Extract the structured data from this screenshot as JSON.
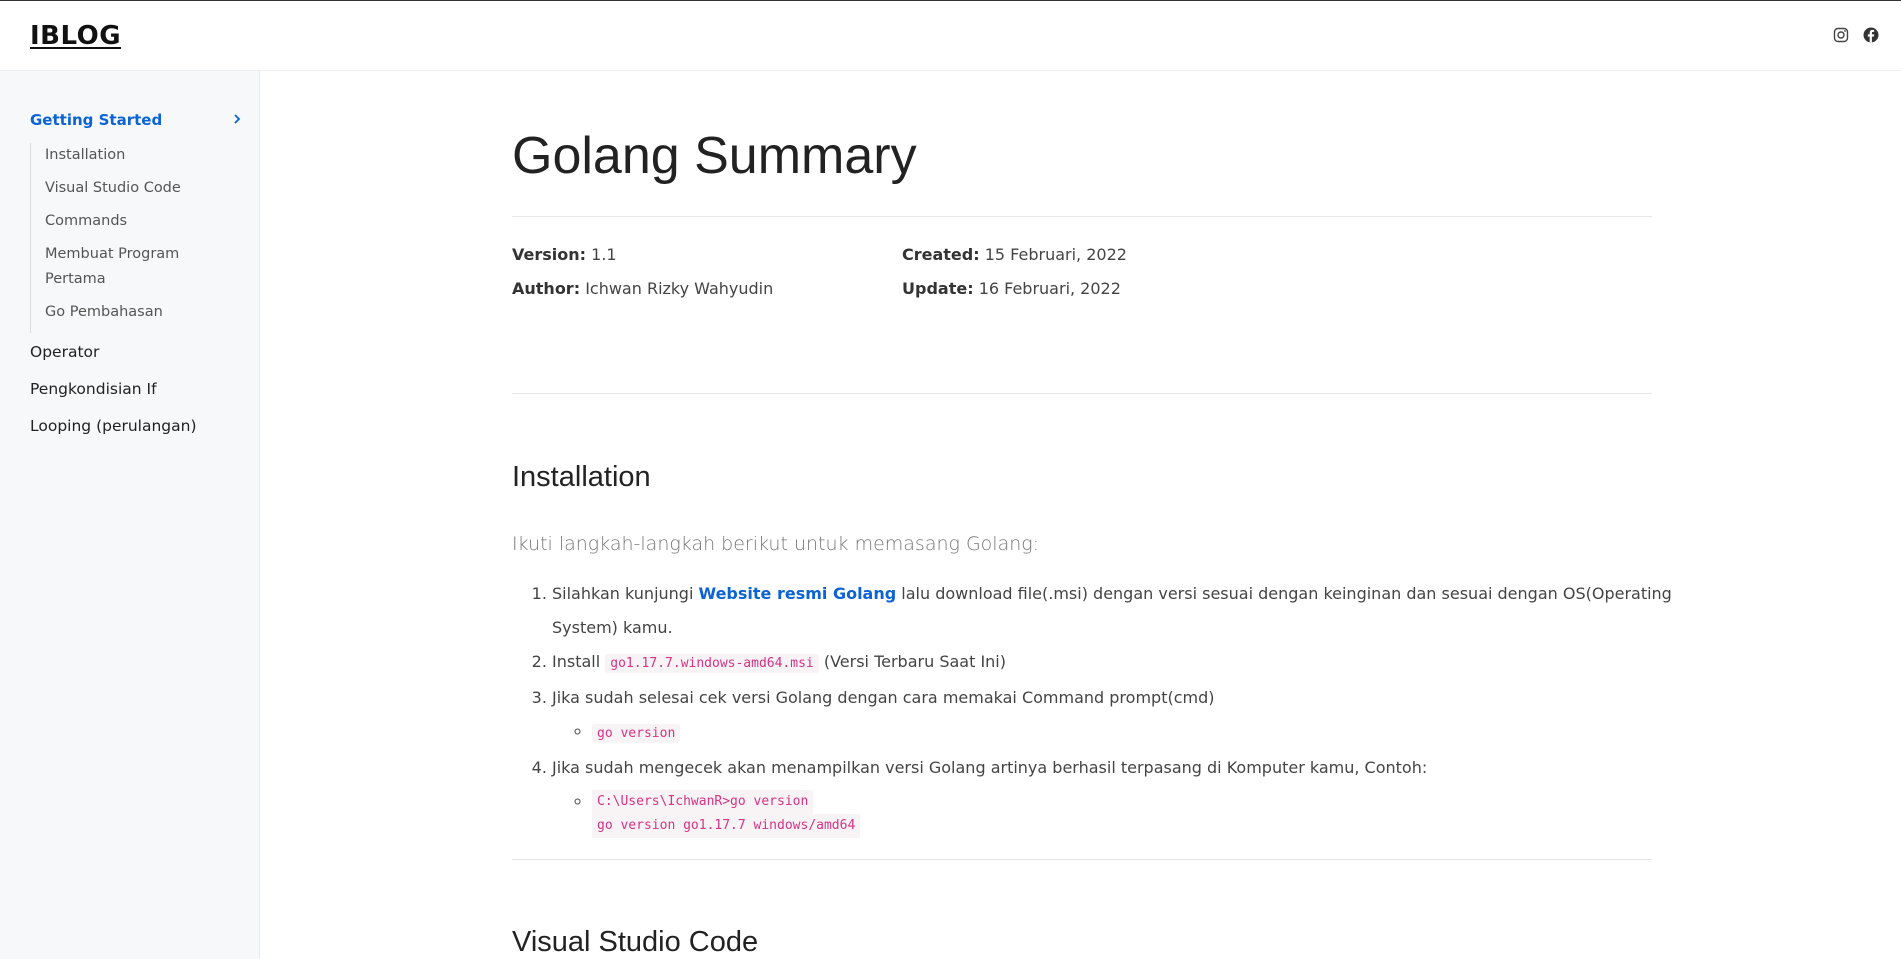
{
  "header": {
    "brand": "IBLOG",
    "icons": [
      "instagram-icon",
      "facebook-icon"
    ]
  },
  "sidebar": {
    "group_title": "Getting Started",
    "sub_items": [
      {
        "label": "Installation"
      },
      {
        "label": "Visual Studio Code"
      },
      {
        "label": "Commands"
      },
      {
        "label": "Membuat Program Pertama"
      },
      {
        "label": "Go Pembahasan"
      }
    ],
    "top_items": [
      {
        "label": "Operator"
      },
      {
        "label": "Pengkondisian If"
      },
      {
        "label": "Looping (perulangan)"
      }
    ]
  },
  "main": {
    "title": "Golang Summary",
    "meta": {
      "version_label": "Version:",
      "version_value": "1.1",
      "author_label": "Author:",
      "author_value": "Ichwan Rizky Wahyudin",
      "created_label": "Created:",
      "created_value": "15 Februari, 2022",
      "update_label": "Update:",
      "update_value": "16 Februari, 2022"
    },
    "installation": {
      "heading": "Installation",
      "lead": "Ikuti langkah-langkah berikut untuk memasang Golang:",
      "step1_pre": "Silahkan kunjungi ",
      "step1_link": "Website resmi Golang",
      "step1_post": " lalu download file(.msi) dengan versi sesuai dengan keinginan dan sesuai dengan OS(Operating System) kamu.",
      "step2_pre": "Install ",
      "step2_code": "go1.17.7.windows-amd64.msi",
      "step2_post": " (Versi Terbaru Saat Ini)",
      "step3": "Jika sudah selesai cek versi Golang dengan cara memakai Command prompt(cmd)",
      "step3_code": "go version",
      "step4": "Jika sudah mengecek akan menampilkan versi Golang artinya berhasil terpasang di Komputer kamu, Contoh:",
      "step4_code_line1": "C:\\Users\\IchwanR>go version",
      "step4_code_line2": "go version go1.17.7 windows/amd64"
    },
    "next_heading": "Visual Studio Code"
  },
  "colors": {
    "accent": "#0b63d6",
    "code": "#d63384"
  }
}
